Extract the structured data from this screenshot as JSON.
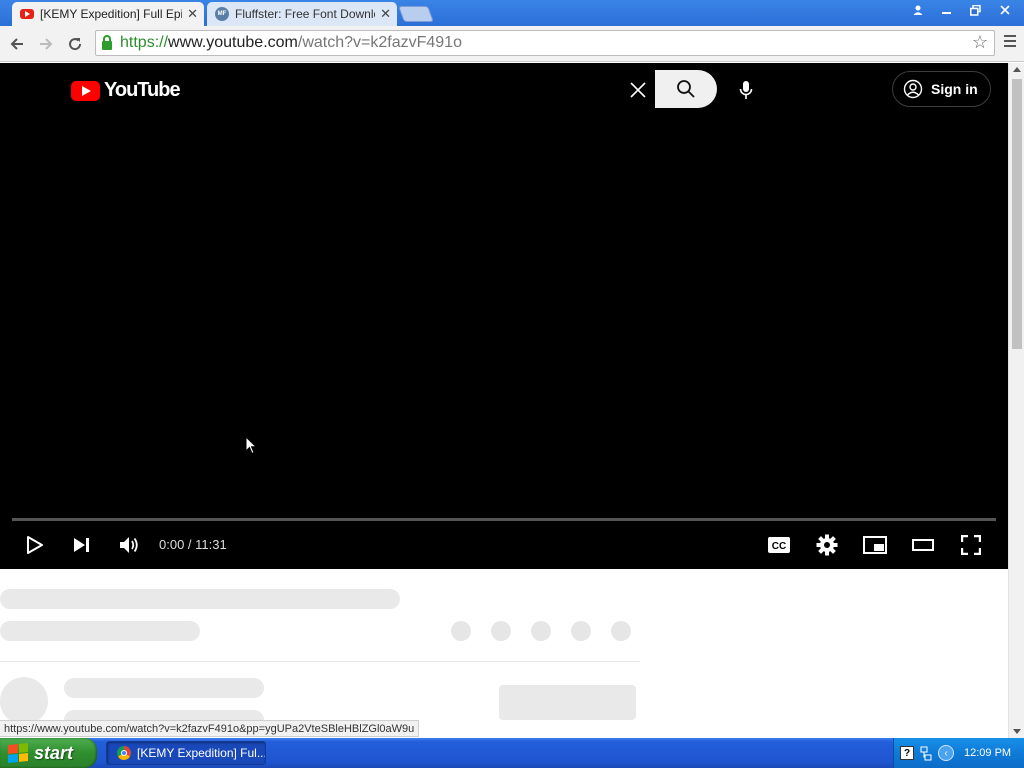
{
  "browser": {
    "tabs": [
      {
        "title": "[KEMY Expedition] Full Episod",
        "favicon": "youtube-icon",
        "active": true
      },
      {
        "title": "Fluffster: Free Font Downloa",
        "favicon": "fontspace-icon",
        "active": false
      }
    ],
    "address": {
      "scheme": "https://",
      "host": "www.youtube.com",
      "path": "/watch?v=k2fazvF491o"
    },
    "status_url": "https://www.youtube.com/watch?v=k2fazvF491o&pp=ygUPa2VteSBleHBlZGl0aW9u"
  },
  "youtube": {
    "logo_text": "YouTube",
    "signin_label": "Sign in",
    "colors": {
      "brand_red": "#ff0000",
      "player_bg": "#000000"
    }
  },
  "player": {
    "time_display": "0:00 / 11:31",
    "progress_fraction": 0,
    "icons": [
      "play-icon",
      "next-icon",
      "volume-icon",
      "captions-icon",
      "settings-icon",
      "miniplayer-icon",
      "theater-mode-icon",
      "fullscreen-icon"
    ]
  },
  "taskbar": {
    "start_label": "start",
    "task_title": "[KEMY Expedition] Ful...",
    "clock": "12:09 PM"
  }
}
